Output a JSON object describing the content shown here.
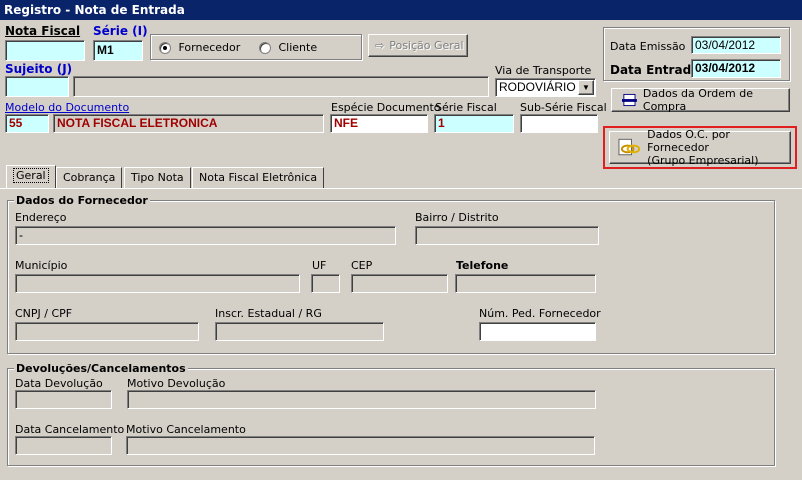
{
  "window": {
    "title": "Registro - Nota de Entrada"
  },
  "header": {
    "nota_fiscal_label": "Nota Fiscal",
    "nota_fiscal_value": "",
    "serie_label": "Série (I)",
    "serie_value": "M1",
    "radio_fornecedor": "Fornecedor",
    "radio_cliente": "Cliente",
    "posicao_geral": "Posição Geral",
    "sujeito_label": "Sujeito (J)",
    "sujeito_code": "",
    "sujeito_name": "",
    "via_transporte_label": "Via de Transporte",
    "via_transporte_value": "RODOVIÁRIO",
    "modelo_label": "Modelo do Documento",
    "modelo_code": "55",
    "modelo_name": "NOTA FISCAL ELETRONICA",
    "especie_label": "Espécie Documento",
    "especie_value": "NFE",
    "serie_fiscal_label": "Série Fiscal",
    "serie_fiscal_value": "1",
    "sub_serie_label": "Sub-Série Fiscal",
    "sub_serie_value": "",
    "data_emissao_label": "Data Emissão",
    "data_emissao_value": "03/04/2012",
    "data_entrada_label": "Data Entrada",
    "data_entrada_value": "03/04/2012",
    "btn_ordem_compra": "Dados da Ordem de Compra",
    "btn_oc_fornecedor_l1": "Dados O.C. por Fornecedor",
    "btn_oc_fornecedor_l2": "(Grupo Empresarial)"
  },
  "tabs": [
    "Geral",
    "Cobrança",
    "Tipo Nota",
    "Nota Fiscal Eletrônica"
  ],
  "fornecedor": {
    "title": "Dados do Fornecedor",
    "endereco_label": "Endereço",
    "endereco_value": "-",
    "bairro_label": "Bairro / Distrito",
    "municipio_label": "Município",
    "uf_label": "UF",
    "cep_label": "CEP",
    "telefone_label": "Telefone",
    "cnpj_label": "CNPJ / CPF",
    "inscr_label": "Inscr. Estadual / RG",
    "num_ped_label": "Núm. Ped. Fornecedor"
  },
  "devolucoes": {
    "title": "Devoluções/Cancelamentos",
    "data_devolucao_label": "Data Devolução",
    "motivo_devolucao_label": "Motivo Devolução",
    "data_cancelamento_label": "Data Cancelamento",
    "motivo_cancelamento_label": "Motivo Cancelamento"
  }
}
